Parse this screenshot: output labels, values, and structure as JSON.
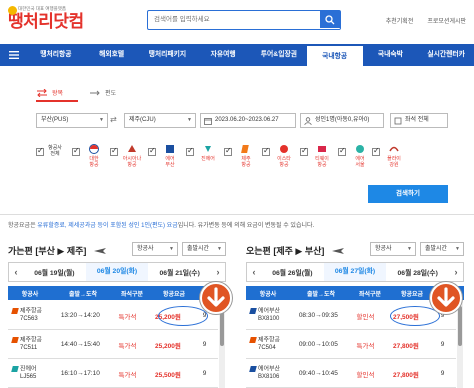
{
  "header": {
    "tagline": "대한민국 대표 여행플랫폼",
    "brand": "땡처리닷컴",
    "search_placeholder": "검색어를 입력하세요",
    "links": [
      "추천기획전",
      "프로모션게시판"
    ]
  },
  "nav": {
    "items": [
      "땡처리항공",
      "해외호텔",
      "땡처리패키지",
      "자유여행",
      "투어&입장권",
      "국내항공",
      "국내숙박",
      "실시간렌터카"
    ],
    "active_index": 5
  },
  "form": {
    "trip_types": [
      "왕복",
      "편도"
    ],
    "trip_active": 0,
    "origin": "부산(PUS)",
    "destination": "제주(CJU)",
    "dates": "2023.06.20~2023.06.27",
    "passengers": "성인1명(아동0,유아0)",
    "seat_class": "좌석 전체",
    "airlines_label": [
      "항공사",
      "전체"
    ],
    "airlines": [
      {
        "line1": "대한",
        "line2": "항공"
      },
      {
        "line1": "아시아나",
        "line2": "항공"
      },
      {
        "line1": "에어",
        "line2": "부산"
      },
      {
        "line1": "진에어",
        "line2": ""
      },
      {
        "line1": "제주",
        "line2": "항공"
      },
      {
        "line1": "이스타",
        "line2": "항공"
      },
      {
        "line1": "티웨이",
        "line2": "항공"
      },
      {
        "line1": "에어",
        "line2": "서울"
      },
      {
        "line1": "플라이",
        "line2": "강원"
      }
    ],
    "search_button": "검색하기"
  },
  "notice": {
    "prefix": "항공요금은 ",
    "hl1": "유류할증료, 제세공과금 등이 포함된 성인 1인(편도) 요금",
    "suffix": "입니다. 유가변동 등에 의해 요금이 변동될 수 있습니다."
  },
  "outbound": {
    "title_prefix": "가는편 ",
    "route": "[부산 ▶ 제주]",
    "filter_airline": "항공사",
    "filter_time": "출발시간",
    "dates": [
      "06월 19일(월)",
      "06월 20일(화)",
      "06월 21일(수)"
    ],
    "active_date": 1,
    "columns": [
      "항공사",
      "출발→도착",
      "좌석구분",
      "항공요금",
      "좌석"
    ],
    "rows": [
      {
        "airline": "제주항공",
        "flight": "7C563",
        "time": "13:20→14:20",
        "seat_type": "특가석",
        "price": "25,200원",
        "seats": "9"
      },
      {
        "airline": "제주항공",
        "flight": "7C511",
        "time": "14:40→15:40",
        "seat_type": "특가석",
        "price": "25,200원",
        "seats": "9"
      },
      {
        "airline": "진에어",
        "flight": "LJ565",
        "time": "16:10→17:10",
        "seat_type": "특가석",
        "price": "25,500원",
        "seats": "9"
      }
    ]
  },
  "return": {
    "title_prefix": "오는편 ",
    "route": "[제주 ▶ 부산]",
    "filter_airline": "항공사",
    "filter_time": "출발시간",
    "dates": [
      "06월 26일(월)",
      "06월 27일(화)",
      "06월 28일(수)"
    ],
    "active_date": 1,
    "columns": [
      "항공사",
      "출발→도착",
      "좌석구분",
      "항공요금",
      "좌석"
    ],
    "rows": [
      {
        "airline": "에어부산",
        "flight": "BX8100",
        "time": "08:30→09:35",
        "seat_type": "할인석",
        "price": "27,500원",
        "seats": "9"
      },
      {
        "airline": "제주항공",
        "flight": "7C504",
        "time": "09:00→10:05",
        "seat_type": "특가석",
        "price": "27,800원",
        "seats": "9"
      },
      {
        "airline": "에어부산",
        "flight": "BX8106",
        "time": "09:40→10:45",
        "seat_type": "할인석",
        "price": "27,800원",
        "seats": "9"
      }
    ]
  },
  "colors": {
    "brand_red": "#e4322b",
    "nav_blue": "#1c57b8",
    "header_blue": "#1f6fd1",
    "button_blue": "#1e88e5",
    "arrow_orange": "#e05524"
  }
}
